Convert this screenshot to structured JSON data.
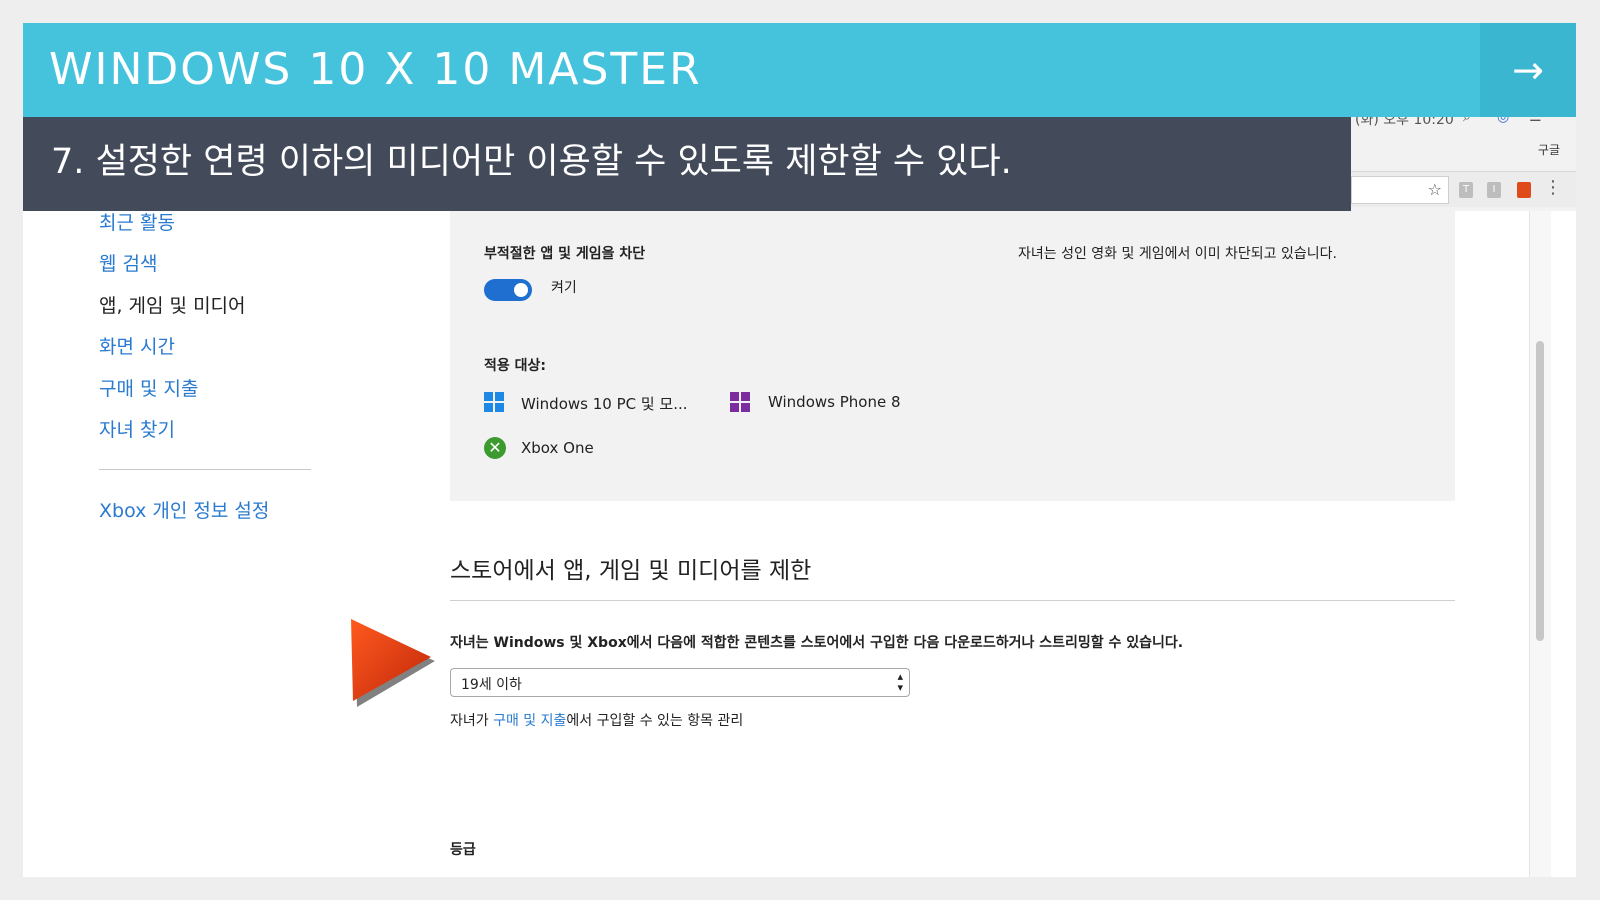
{
  "banner": {
    "title": "WINDOWS 10 X 10 MASTER",
    "arrow": "→"
  },
  "caption": {
    "text": "7. 설정한 연령 이하의 미디어만 이용할 수 있도록 제한할 수 있다."
  },
  "browser": {
    "clock_text": "(화) 오후 10:20",
    "search_provider": "구글",
    "star_glyph": "☆",
    "menu_glyph": "⋮",
    "ext_t": "T",
    "ext_i": "I"
  },
  "sidebar": {
    "items": [
      {
        "label": "최근 활동",
        "current": false
      },
      {
        "label": "웹 검색",
        "current": false
      },
      {
        "label": "앱, 게임 및 미디어",
        "current": true
      },
      {
        "label": "화면 시간",
        "current": false
      },
      {
        "label": "구매 및 지출",
        "current": false
      },
      {
        "label": "자녀 찾기",
        "current": false
      }
    ],
    "xbox_privacy": "Xbox 개인 정보 설정"
  },
  "block_panel": {
    "heading": "부적절한 앱 및 게임을 차단",
    "toggle_state": "on",
    "toggle_label": "켜기",
    "note": "자녀는 성인 영화 및 게임에서 이미 차단되고 있습니다.",
    "applies_to_label": "적용 대상:",
    "devices": [
      {
        "name": "Windows 10 PC 및 모...",
        "icon": "windows-icon",
        "color": "#1e88e5"
      },
      {
        "name": "Windows Phone 8",
        "icon": "windows-icon",
        "color": "#7b2c9e"
      },
      {
        "name": "Xbox One",
        "icon": "xbox-icon",
        "color": "#3c9a2f"
      }
    ]
  },
  "store_section": {
    "title": "스토어에서 앱, 게임 및 미디어를 제한",
    "description": "자녀는 Windows 및 Xbox에서 다음에 적합한 콘텐츠를 스토어에서 구입한 다음 다운로드하거나 스트리밍할 수 있습니다.",
    "age_select": {
      "value": "19세 이하",
      "arrows": "▲▼"
    },
    "manage_prefix": "자녀가 ",
    "manage_link": "구매 및 지출",
    "manage_suffix": "에서 구입할 수 있는 항목 관리",
    "rating_label": "등급"
  },
  "colors": {
    "banner": "#45c3dd",
    "caption_bg": "#434a5a",
    "link": "#2a7ad0",
    "toggle_on": "#1f6fd1",
    "pointer_arrow": "#e03a10"
  }
}
